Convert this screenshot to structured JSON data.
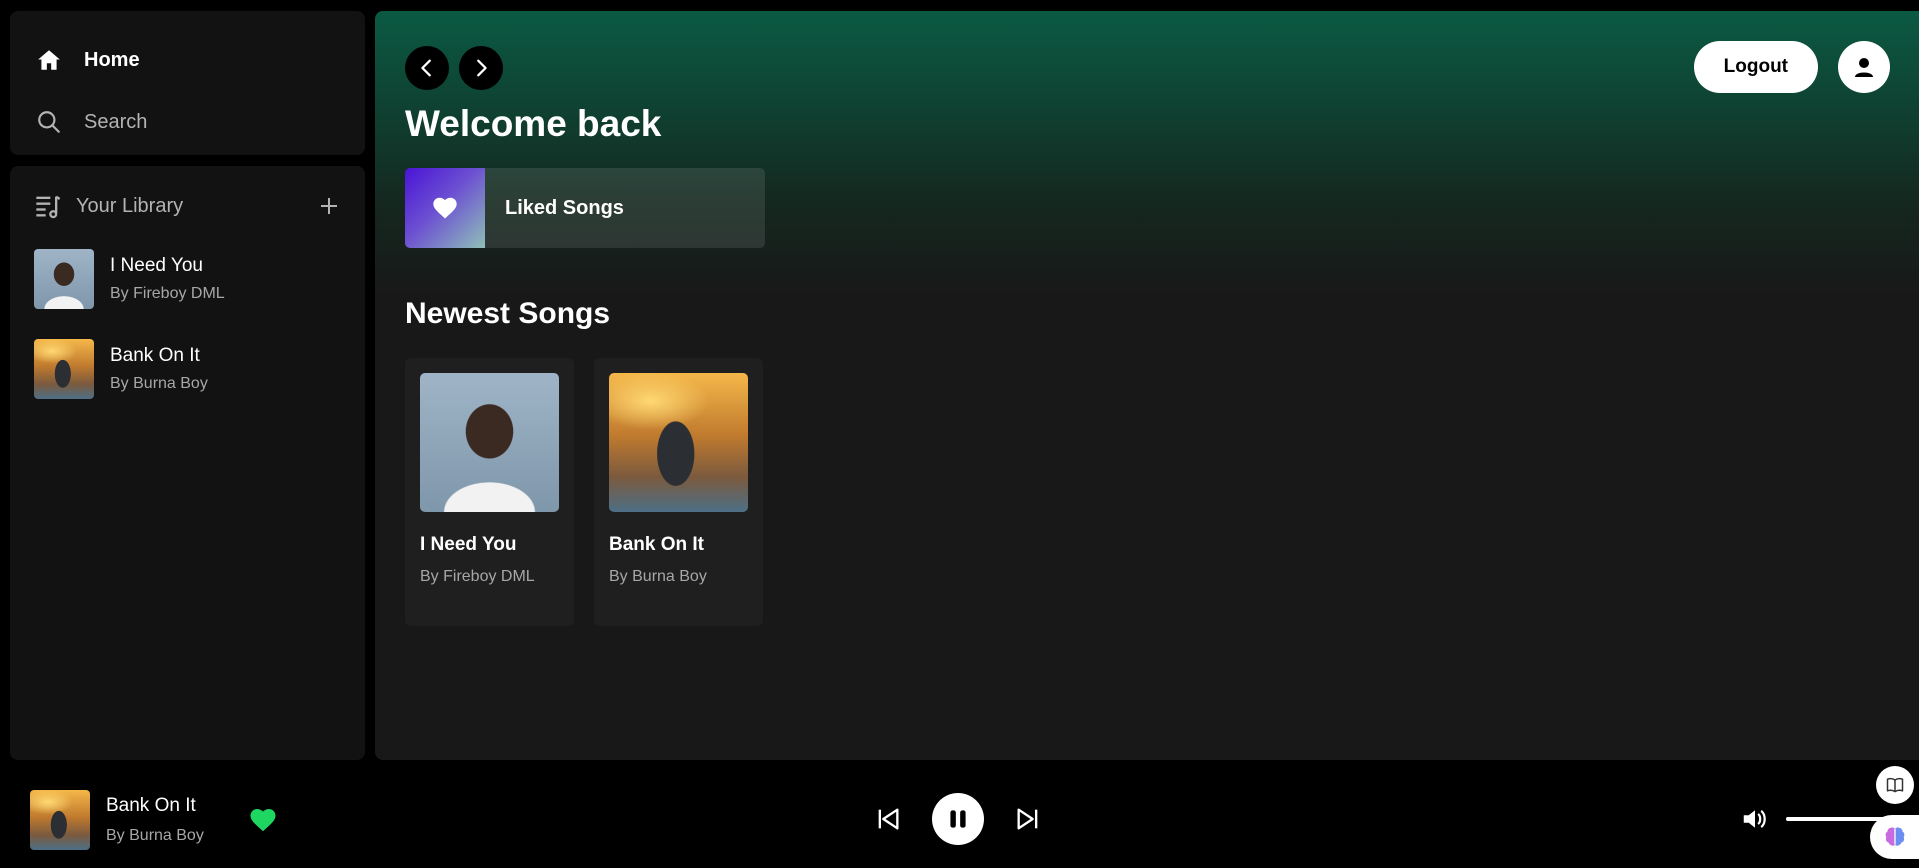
{
  "sidebar": {
    "nav": [
      {
        "label": "Home",
        "icon": "home-icon"
      },
      {
        "label": "Search",
        "icon": "search-icon"
      }
    ],
    "library": {
      "title": "Your Library",
      "items": [
        {
          "title": "I Need You",
          "artist": "By Fireboy DML"
        },
        {
          "title": "Bank On It",
          "artist": "By Burna Boy"
        }
      ]
    }
  },
  "header": {
    "logout_label": "Logout"
  },
  "main": {
    "welcome": "Welcome back",
    "liked_songs_label": "Liked Songs",
    "section_title": "Newest Songs",
    "songs": [
      {
        "title": "I Need You",
        "artist": "By Fireboy DML"
      },
      {
        "title": "Bank On It",
        "artist": "By Burna Boy"
      }
    ]
  },
  "player": {
    "now_playing": {
      "title": "Bank On It",
      "artist": "By Burna Boy",
      "liked": true
    },
    "volume_level": 0.75,
    "accent_color": "#1ed760"
  }
}
